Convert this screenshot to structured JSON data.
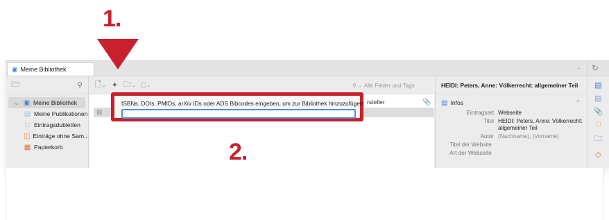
{
  "annotations": {
    "step1": "1.",
    "step2": "2."
  },
  "tabbar": {
    "tab_title": "Meine Bibliothek"
  },
  "sidebar": {
    "items": [
      {
        "label": "Meine Bibliothek",
        "icon": "library-icon"
      },
      {
        "label": "Meine Publikationen",
        "icon": "publications-icon"
      },
      {
        "label": "Eintragsdubletten",
        "icon": "duplicates-icon"
      },
      {
        "label": "Einträge ohne Sam...",
        "icon": "unfiled-icon"
      },
      {
        "label": "Papierkorb",
        "icon": "trash-icon"
      }
    ]
  },
  "center": {
    "search_placeholder": "Alle Felder und Tags",
    "column_header": "rsteller"
  },
  "popover": {
    "label": "ISBNs, DOIs, PMIDs, arXiv IDs oder ADS Bibcodes eingeben, um zur Bibliothek hinzuzufügen:",
    "value": ""
  },
  "right": {
    "title": "HEIDI: Peters, Anne: Völkerrecht: allgemeiner Teil",
    "section": "Infos",
    "fields": [
      {
        "key": "Eintragsart",
        "value": "Webseite"
      },
      {
        "key": "Titel",
        "value": "HEIDI: Peters, Anne: Völkerrecht: allgemeiner Teil"
      },
      {
        "key": "Autor",
        "value": "(Nachname), (Vorname)"
      },
      {
        "key": "Titel der Website",
        "value": ""
      },
      {
        "key": "Art der Webseite",
        "value": ""
      }
    ]
  },
  "colors": {
    "annotation_red": "#c8202c",
    "input_focus": "#4a90e2",
    "accent_blue": "#4a86d6"
  }
}
